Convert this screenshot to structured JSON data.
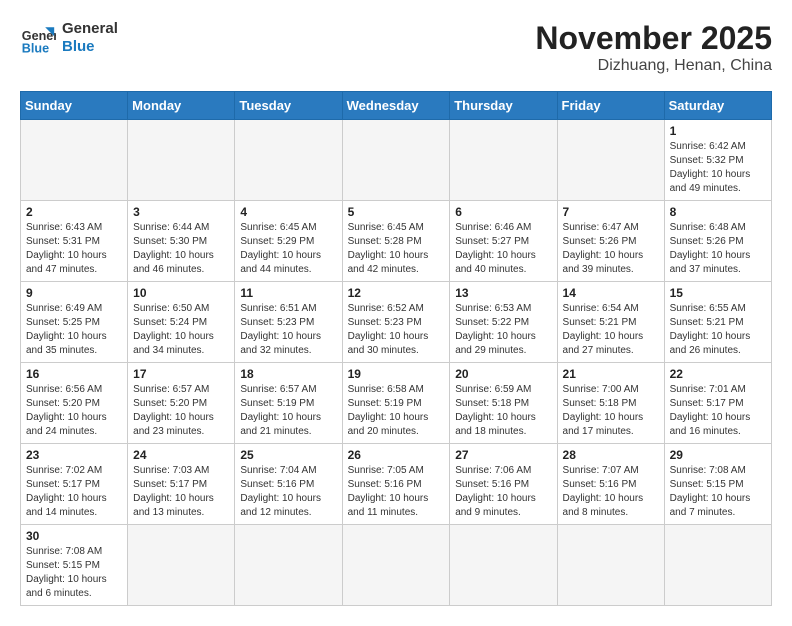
{
  "header": {
    "logo_general": "General",
    "logo_blue": "Blue",
    "month_title": "November 2025",
    "location": "Dizhuang, Henan, China"
  },
  "weekdays": [
    "Sunday",
    "Monday",
    "Tuesday",
    "Wednesday",
    "Thursday",
    "Friday",
    "Saturday"
  ],
  "days": [
    {
      "num": "",
      "info": ""
    },
    {
      "num": "",
      "info": ""
    },
    {
      "num": "",
      "info": ""
    },
    {
      "num": "",
      "info": ""
    },
    {
      "num": "",
      "info": ""
    },
    {
      "num": "",
      "info": ""
    },
    {
      "num": "1",
      "info": "Sunrise: 6:42 AM\nSunset: 5:32 PM\nDaylight: 10 hours and 49 minutes."
    },
    {
      "num": "2",
      "info": "Sunrise: 6:43 AM\nSunset: 5:31 PM\nDaylight: 10 hours and 47 minutes."
    },
    {
      "num": "3",
      "info": "Sunrise: 6:44 AM\nSunset: 5:30 PM\nDaylight: 10 hours and 46 minutes."
    },
    {
      "num": "4",
      "info": "Sunrise: 6:45 AM\nSunset: 5:29 PM\nDaylight: 10 hours and 44 minutes."
    },
    {
      "num": "5",
      "info": "Sunrise: 6:45 AM\nSunset: 5:28 PM\nDaylight: 10 hours and 42 minutes."
    },
    {
      "num": "6",
      "info": "Sunrise: 6:46 AM\nSunset: 5:27 PM\nDaylight: 10 hours and 40 minutes."
    },
    {
      "num": "7",
      "info": "Sunrise: 6:47 AM\nSunset: 5:26 PM\nDaylight: 10 hours and 39 minutes."
    },
    {
      "num": "8",
      "info": "Sunrise: 6:48 AM\nSunset: 5:26 PM\nDaylight: 10 hours and 37 minutes."
    },
    {
      "num": "9",
      "info": "Sunrise: 6:49 AM\nSunset: 5:25 PM\nDaylight: 10 hours and 35 minutes."
    },
    {
      "num": "10",
      "info": "Sunrise: 6:50 AM\nSunset: 5:24 PM\nDaylight: 10 hours and 34 minutes."
    },
    {
      "num": "11",
      "info": "Sunrise: 6:51 AM\nSunset: 5:23 PM\nDaylight: 10 hours and 32 minutes."
    },
    {
      "num": "12",
      "info": "Sunrise: 6:52 AM\nSunset: 5:23 PM\nDaylight: 10 hours and 30 minutes."
    },
    {
      "num": "13",
      "info": "Sunrise: 6:53 AM\nSunset: 5:22 PM\nDaylight: 10 hours and 29 minutes."
    },
    {
      "num": "14",
      "info": "Sunrise: 6:54 AM\nSunset: 5:21 PM\nDaylight: 10 hours and 27 minutes."
    },
    {
      "num": "15",
      "info": "Sunrise: 6:55 AM\nSunset: 5:21 PM\nDaylight: 10 hours and 26 minutes."
    },
    {
      "num": "16",
      "info": "Sunrise: 6:56 AM\nSunset: 5:20 PM\nDaylight: 10 hours and 24 minutes."
    },
    {
      "num": "17",
      "info": "Sunrise: 6:57 AM\nSunset: 5:20 PM\nDaylight: 10 hours and 23 minutes."
    },
    {
      "num": "18",
      "info": "Sunrise: 6:57 AM\nSunset: 5:19 PM\nDaylight: 10 hours and 21 minutes."
    },
    {
      "num": "19",
      "info": "Sunrise: 6:58 AM\nSunset: 5:19 PM\nDaylight: 10 hours and 20 minutes."
    },
    {
      "num": "20",
      "info": "Sunrise: 6:59 AM\nSunset: 5:18 PM\nDaylight: 10 hours and 18 minutes."
    },
    {
      "num": "21",
      "info": "Sunrise: 7:00 AM\nSunset: 5:18 PM\nDaylight: 10 hours and 17 minutes."
    },
    {
      "num": "22",
      "info": "Sunrise: 7:01 AM\nSunset: 5:17 PM\nDaylight: 10 hours and 16 minutes."
    },
    {
      "num": "23",
      "info": "Sunrise: 7:02 AM\nSunset: 5:17 PM\nDaylight: 10 hours and 14 minutes."
    },
    {
      "num": "24",
      "info": "Sunrise: 7:03 AM\nSunset: 5:17 PM\nDaylight: 10 hours and 13 minutes."
    },
    {
      "num": "25",
      "info": "Sunrise: 7:04 AM\nSunset: 5:16 PM\nDaylight: 10 hours and 12 minutes."
    },
    {
      "num": "26",
      "info": "Sunrise: 7:05 AM\nSunset: 5:16 PM\nDaylight: 10 hours and 11 minutes."
    },
    {
      "num": "27",
      "info": "Sunrise: 7:06 AM\nSunset: 5:16 PM\nDaylight: 10 hours and 9 minutes."
    },
    {
      "num": "28",
      "info": "Sunrise: 7:07 AM\nSunset: 5:16 PM\nDaylight: 10 hours and 8 minutes."
    },
    {
      "num": "29",
      "info": "Sunrise: 7:08 AM\nSunset: 5:15 PM\nDaylight: 10 hours and 7 minutes."
    },
    {
      "num": "30",
      "info": "Sunrise: 7:08 AM\nSunset: 5:15 PM\nDaylight: 10 hours and 6 minutes."
    },
    {
      "num": "",
      "info": ""
    },
    {
      "num": "",
      "info": ""
    },
    {
      "num": "",
      "info": ""
    },
    {
      "num": "",
      "info": ""
    },
    {
      "num": "",
      "info": ""
    }
  ]
}
